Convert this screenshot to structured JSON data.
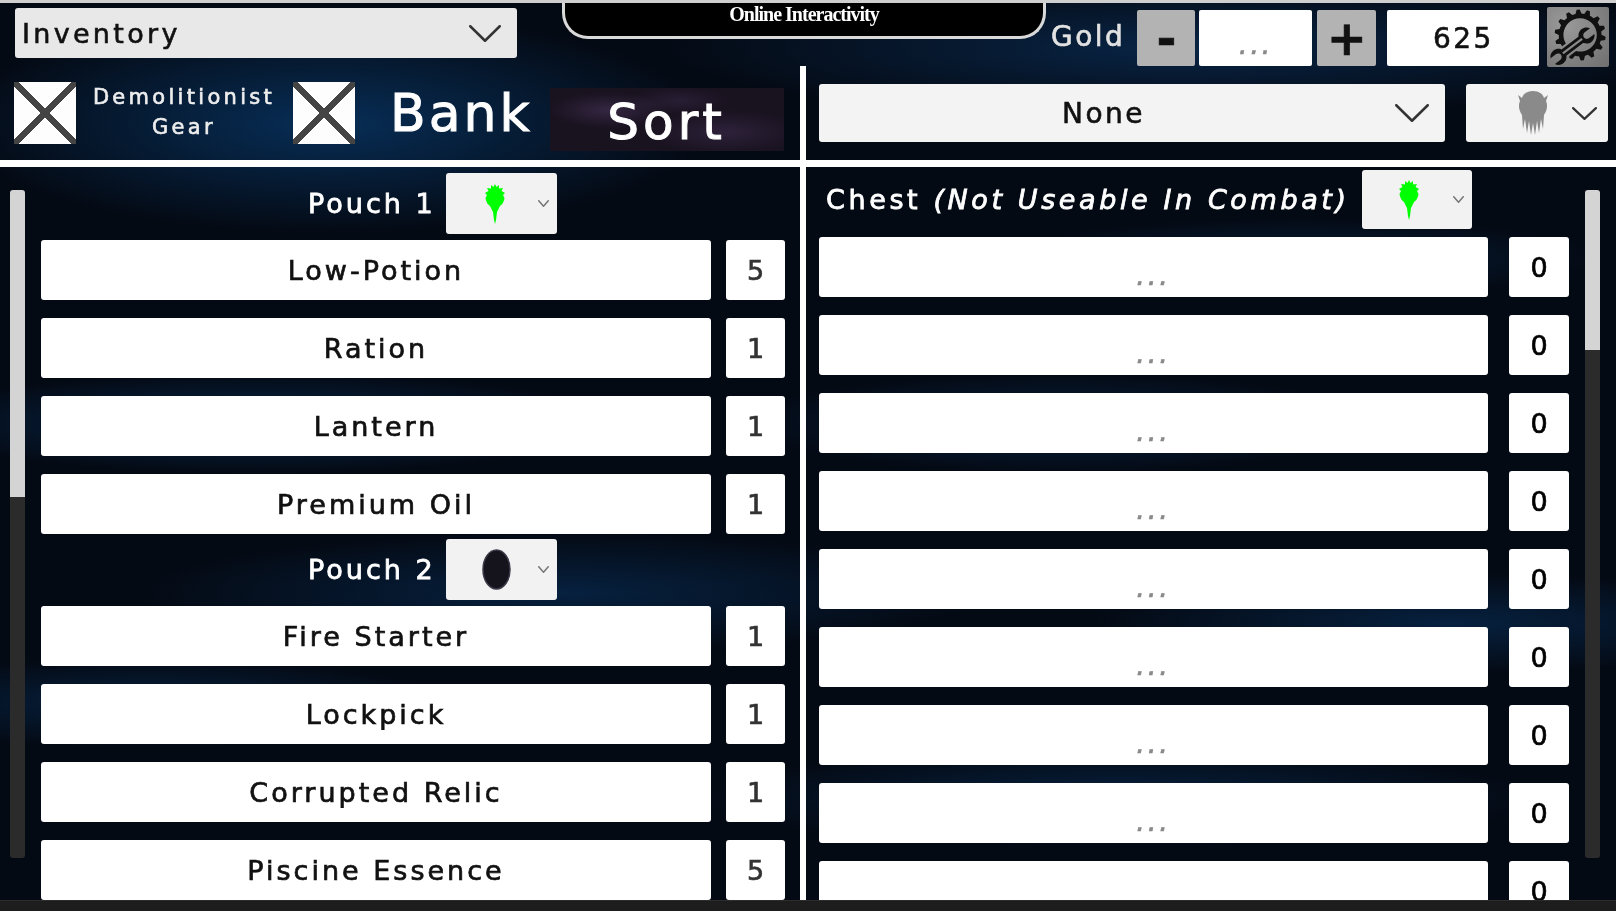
{
  "section_select": {
    "value": "Inventory"
  },
  "title": "Online Interactivity",
  "gold": {
    "label": "Gold",
    "decrease": "-",
    "amount": {
      "placeholder": "..."
    },
    "increase": "+",
    "total": {
      "value": "625"
    }
  },
  "gear_toggle": {
    "label": "Demolitionist Gear",
    "checked": true
  },
  "bank_toggle": {
    "label": "Bank",
    "checked": true
  },
  "sort_button": "Sort",
  "bank_filter": {
    "value": "None"
  },
  "pouches": [
    {
      "title": "Pouch 1",
      "kind": "figure",
      "color": "#00ff00",
      "items": [
        {
          "name": "Low-Potion",
          "count": "5"
        },
        {
          "name": "Ration",
          "count": "1"
        },
        {
          "name": "Lantern",
          "count": "1"
        },
        {
          "name": "Premium Oil",
          "count": "1"
        }
      ]
    },
    {
      "title": "Pouch 2",
      "kind": "oval",
      "color": "#15131c",
      "items": [
        {
          "name": "Fire Starter",
          "count": "1"
        },
        {
          "name": "Lockpick",
          "count": "1"
        },
        {
          "name": "Corrupted Relic",
          "count": "1"
        },
        {
          "name": "Piscine Essence",
          "count": "5"
        }
      ]
    }
  ],
  "chest": {
    "title": "Chest *(Not Useable In Combat)*",
    "kind": "figure",
    "color": "#00ff00",
    "slots": [
      {
        "placeholder": "...",
        "count": "0"
      },
      {
        "placeholder": "...",
        "count": "0"
      },
      {
        "placeholder": "...",
        "count": "0"
      },
      {
        "placeholder": "...",
        "count": "0"
      },
      {
        "placeholder": "...",
        "count": "0"
      },
      {
        "placeholder": "...",
        "count": "0"
      },
      {
        "placeholder": "...",
        "count": "0"
      },
      {
        "placeholder": "...",
        "count": "0"
      },
      {
        "count": "0"
      }
    ]
  }
}
